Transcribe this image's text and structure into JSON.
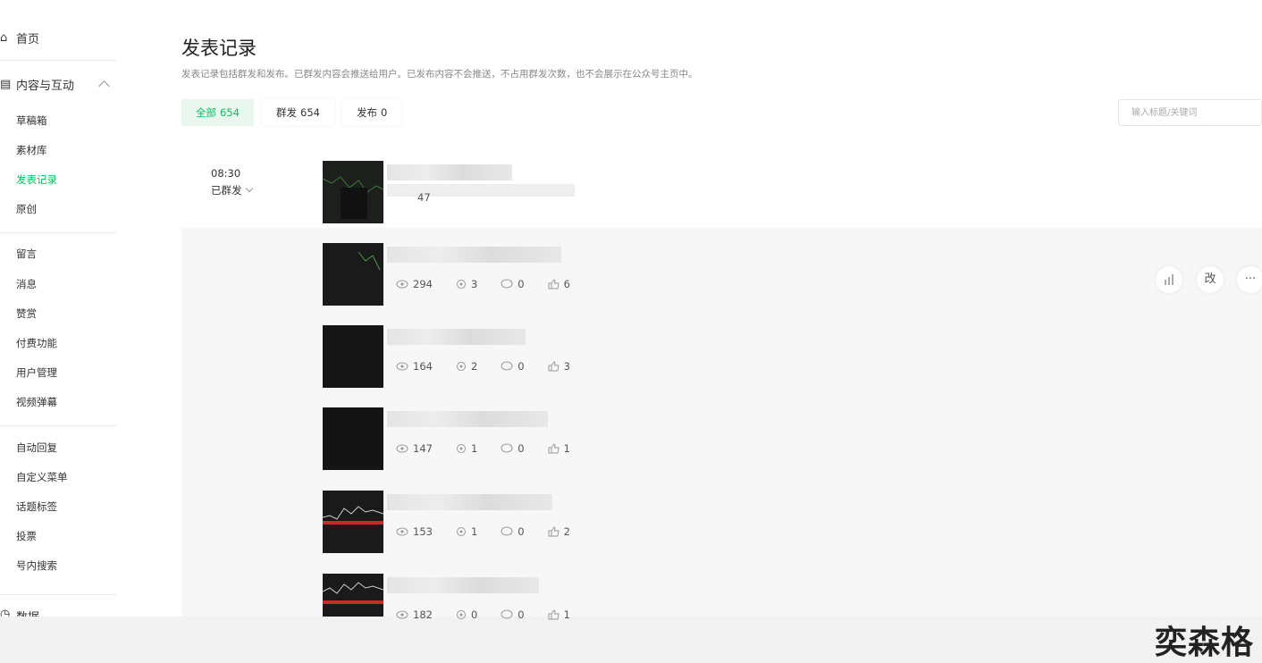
{
  "sidebar": {
    "home": "首页",
    "content_group": "内容与互动",
    "content_items": [
      "草稿箱",
      "素材库",
      "发表记录",
      "原创"
    ],
    "interaction_items": [
      "留言",
      "消息",
      "赞赏",
      "付费功能",
      "用户管理",
      "视频弹幕"
    ],
    "feature_items": [
      "自动回复",
      "自定义菜单",
      "话题标签",
      "投票",
      "号内搜索"
    ],
    "data_group": "数据"
  },
  "header": {
    "title": "发表记录",
    "description": "发表记录包括群发和发布。已群发内容会推送给用户。已发布内容不会推送，不占用群发次数，也不会展示在公众号主页中。"
  },
  "tabs": [
    {
      "label": "全部",
      "count": "654"
    },
    {
      "label": "群发",
      "count": "654"
    },
    {
      "label": "发布",
      "count": "0"
    }
  ],
  "search": {
    "placeholder": "输入标题/关键词"
  },
  "record": {
    "time": "08:30",
    "status": "已群发"
  },
  "posts": [
    {
      "reads": "47",
      "shares": "",
      "comments": "",
      "likes": ""
    },
    {
      "reads": "294",
      "shares": "3",
      "comments": "0",
      "likes": "6"
    },
    {
      "reads": "164",
      "shares": "2",
      "comments": "0",
      "likes": "3"
    },
    {
      "reads": "147",
      "shares": "1",
      "comments": "0",
      "likes": "1"
    },
    {
      "reads": "153",
      "shares": "1",
      "comments": "0",
      "likes": "2"
    },
    {
      "reads": "182",
      "shares": "0",
      "comments": "0",
      "likes": "1"
    }
  ],
  "actions": {
    "edit": "改",
    "more": "···"
  },
  "watermark": "奕森格",
  "colors": {
    "accent": "#07c160",
    "active_tab_bg": "#eaf7ef"
  }
}
